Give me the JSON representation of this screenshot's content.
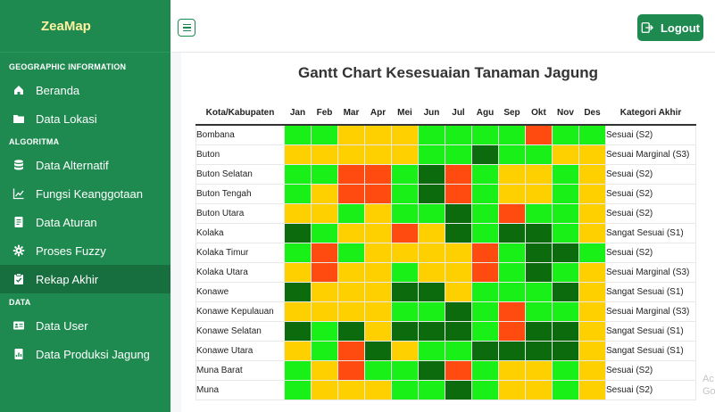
{
  "app": {
    "brand": "ZeaMap"
  },
  "sidebar": {
    "sections": [
      {
        "title": "GEOGRAPHIC INFORMATION",
        "items": [
          {
            "label": "Beranda",
            "icon": "home-icon"
          },
          {
            "label": "Data Lokasi",
            "icon": "folder-icon"
          }
        ]
      },
      {
        "title": "ALGORITMA",
        "items": [
          {
            "label": "Data Alternatif",
            "icon": "database-icon"
          },
          {
            "label": "Fungsi Keanggotaan",
            "icon": "line-chart-icon"
          },
          {
            "label": "Data Aturan",
            "icon": "document-icon"
          },
          {
            "label": "Proses Fuzzy",
            "icon": "gear-icon"
          },
          {
            "label": "Rekap Akhir",
            "icon": "clipboard-icon",
            "active": true
          }
        ]
      },
      {
        "title": "DATA",
        "items": [
          {
            "label": "Data User",
            "icon": "id-card-icon"
          },
          {
            "label": "Data Produksi Jagung",
            "icon": "report-icon"
          }
        ]
      }
    ]
  },
  "topbar": {
    "logout_label": "Logout"
  },
  "chart": {
    "title": "Gantt Chart Kesesuaian Tanaman Jagung",
    "headers": {
      "city": "Kota/Kabupaten",
      "months": [
        "Jan",
        "Feb",
        "Mar",
        "Apr",
        "Mei",
        "Jun",
        "Jul",
        "Agu",
        "Sep",
        "Okt",
        "Nov",
        "Des"
      ],
      "category": "Kategori Akhir"
    },
    "colors": {
      "S1": "#0c6b0c",
      "S2": "#18f018",
      "S3": "#ffd000",
      "N": "#ff4b0f"
    },
    "rows": [
      {
        "city": "Bombana",
        "cells": [
          "S2",
          "S2",
          "S3",
          "S3",
          "S3",
          "S2",
          "S2",
          "S2",
          "S2",
          "N",
          "S2",
          "S2"
        ],
        "category": "Sesuai (S2)"
      },
      {
        "city": "Buton",
        "cells": [
          "S3",
          "S3",
          "S3",
          "S3",
          "S3",
          "S2",
          "S2",
          "S1",
          "S2",
          "S2",
          "S3",
          "S3"
        ],
        "category": "Sesuai Marginal (S3)"
      },
      {
        "city": "Buton Selatan",
        "cells": [
          "S2",
          "S2",
          "N",
          "N",
          "S2",
          "S1",
          "N",
          "S2",
          "S3",
          "S3",
          "S2",
          "S3"
        ],
        "category": "Sesuai (S2)"
      },
      {
        "city": "Buton Tengah",
        "cells": [
          "S2",
          "S3",
          "N",
          "N",
          "S2",
          "S1",
          "N",
          "S2",
          "S3",
          "S3",
          "S2",
          "S3"
        ],
        "category": "Sesuai (S2)"
      },
      {
        "city": "Buton Utara",
        "cells": [
          "S3",
          "S3",
          "S2",
          "S3",
          "S2",
          "S2",
          "S1",
          "S2",
          "N",
          "S2",
          "S2",
          "S3"
        ],
        "category": "Sesuai (S2)"
      },
      {
        "city": "Kolaka",
        "cells": [
          "S1",
          "S2",
          "S3",
          "S3",
          "N",
          "S3",
          "S1",
          "S2",
          "S1",
          "S1",
          "S2",
          "S3"
        ],
        "category": "Sangat Sesuai (S1)"
      },
      {
        "city": "Kolaka Timur",
        "cells": [
          "S2",
          "N",
          "S2",
          "S3",
          "S3",
          "S3",
          "S3",
          "N",
          "S2",
          "S1",
          "S1",
          "S2"
        ],
        "category": "Sesuai (S2)"
      },
      {
        "city": "Kolaka Utara",
        "cells": [
          "S3",
          "N",
          "S3",
          "S3",
          "S2",
          "S3",
          "S3",
          "N",
          "S2",
          "S1",
          "S2",
          "S3"
        ],
        "category": "Sesuai Marginal (S3)"
      },
      {
        "city": "Konawe",
        "cells": [
          "S1",
          "S3",
          "S3",
          "S3",
          "S1",
          "S1",
          "S3",
          "S2",
          "S2",
          "S2",
          "S1",
          "S3"
        ],
        "category": "Sangat Sesuai (S1)"
      },
      {
        "city": "Konawe Kepulauan",
        "cells": [
          "S3",
          "S3",
          "S3",
          "S3",
          "S2",
          "S2",
          "S1",
          "S2",
          "N",
          "S2",
          "S2",
          "S3"
        ],
        "category": "Sesuai Marginal (S3)"
      },
      {
        "city": "Konawe Selatan",
        "cells": [
          "S1",
          "S2",
          "S1",
          "S3",
          "S1",
          "S1",
          "S1",
          "S2",
          "N",
          "S1",
          "S1",
          "S3"
        ],
        "category": "Sangat Sesuai (S1)"
      },
      {
        "city": "Konawe Utara",
        "cells": [
          "S3",
          "S2",
          "N",
          "S1",
          "S3",
          "S2",
          "S2",
          "S1",
          "S1",
          "S1",
          "S1",
          "S3"
        ],
        "category": "Sangat Sesuai (S1)"
      },
      {
        "city": "Muna Barat",
        "cells": [
          "S2",
          "S3",
          "N",
          "S2",
          "S2",
          "S1",
          "N",
          "S2",
          "S3",
          "S3",
          "S2",
          "S3"
        ],
        "category": "Sesuai (S2)"
      },
      {
        "city": "Muna",
        "cells": [
          "S2",
          "S3",
          "S3",
          "S3",
          "S2",
          "S2",
          "S1",
          "S2",
          "S3",
          "S3",
          "S2",
          "S3"
        ],
        "category": "Sesuai (S2)"
      }
    ]
  },
  "watermark": {
    "line1": "Ac",
    "line2": "Go"
  }
}
